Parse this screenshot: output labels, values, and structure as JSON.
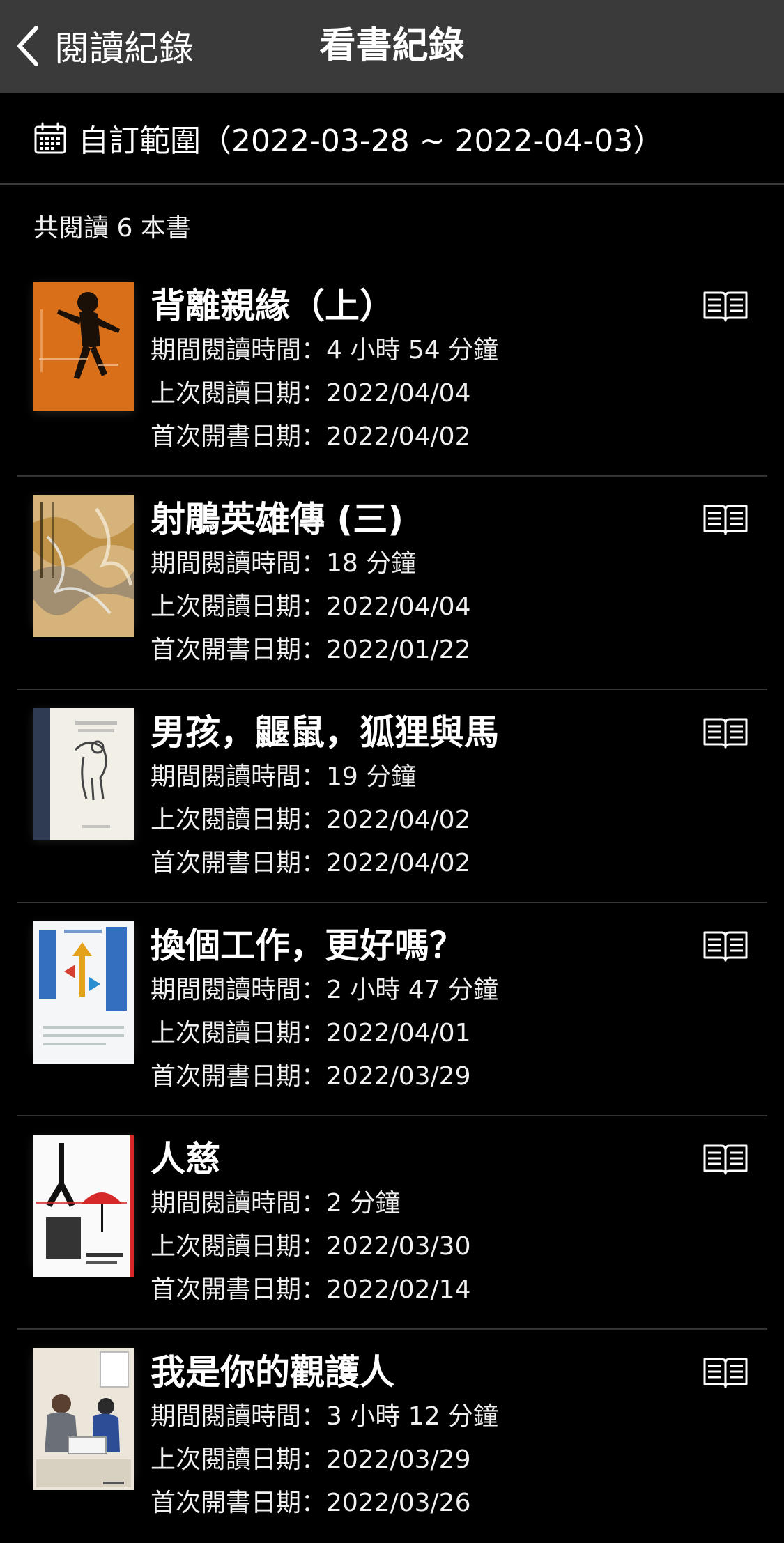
{
  "nav": {
    "back_label": "閱讀紀錄",
    "title": "看書紀錄"
  },
  "range": {
    "label": "自訂範圍（2022-03-28 ~ 2022-04-03）"
  },
  "summary": {
    "total_label": "共閱讀 6 本書"
  },
  "icons": {
    "back": "chevron-left-icon",
    "calendar": "calendar-icon",
    "read": "open-book-icon"
  },
  "colors": {
    "nav_bg": "#3a3a3a",
    "background": "#000000",
    "divider": "#333333",
    "text": "#ffffff"
  },
  "books": [
    {
      "title": "背離親緣（上）",
      "reading_time": "期間閱讀時間：4 小時 54 分鐘",
      "last_read": "上次閱讀日期：2022/04/04",
      "first_opened": "首次開書日期：2022/04/02"
    },
    {
      "title": "射鵰英雄傳 (三)",
      "reading_time": "期間閱讀時間：18 分鐘",
      "last_read": "上次閱讀日期：2022/04/04",
      "first_opened": "首次開書日期：2022/01/22"
    },
    {
      "title": "男孩，鼴鼠，狐狸與馬",
      "reading_time": "期間閱讀時間：19 分鐘",
      "last_read": "上次閱讀日期：2022/04/02",
      "first_opened": "首次開書日期：2022/04/02"
    },
    {
      "title": "換個工作，更好嗎？",
      "reading_time": "期間閱讀時間：2 小時 47 分鐘",
      "last_read": "上次閱讀日期：2022/04/01",
      "first_opened": "首次開書日期：2022/03/29"
    },
    {
      "title": "人慈",
      "reading_time": "期間閱讀時間：2 分鐘",
      "last_read": "上次閱讀日期：2022/03/30",
      "first_opened": "首次開書日期：2022/02/14"
    },
    {
      "title": "我是你的觀護人",
      "reading_time": "期間閱讀時間：3 小時 12 分鐘",
      "last_read": "上次閱讀日期：2022/03/29",
      "first_opened": "首次開書日期：2022/03/26"
    }
  ]
}
